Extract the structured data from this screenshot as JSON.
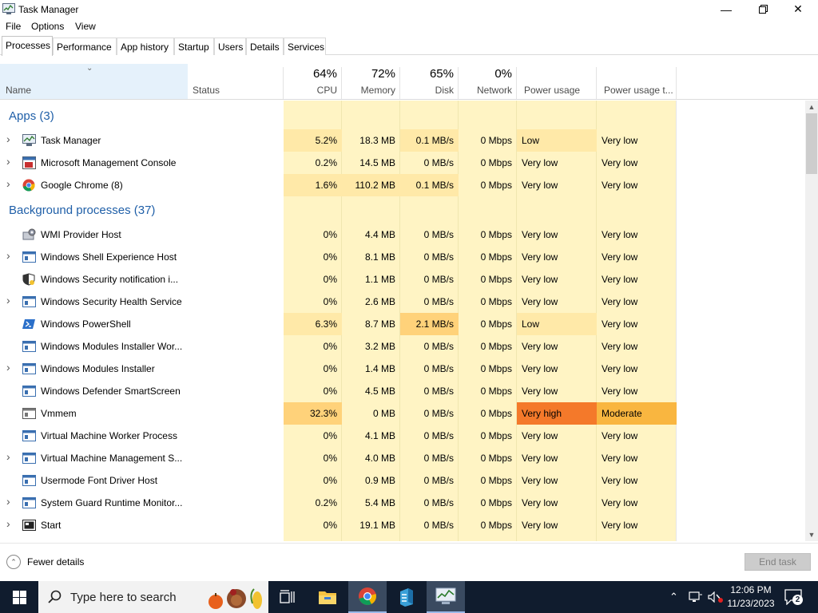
{
  "window": {
    "title": "Task Manager"
  },
  "menu": [
    "File",
    "Options",
    "View"
  ],
  "tabs": [
    "Processes",
    "Performance",
    "App history",
    "Startup",
    "Users",
    "Details",
    "Services"
  ],
  "columns": {
    "name": "Name",
    "status": "Status",
    "cpu": {
      "pct": "64%",
      "label": "CPU"
    },
    "memory": {
      "pct": "72%",
      "label": "Memory"
    },
    "disk": {
      "pct": "65%",
      "label": "Disk"
    },
    "network": {
      "pct": "0%",
      "label": "Network"
    },
    "power": "Power usage",
    "power_trend": "Power usage t..."
  },
  "groups": {
    "apps": "Apps (3)",
    "background": "Background processes (37)"
  },
  "apps": [
    {
      "name": "Task Manager",
      "cpu": "5.2%",
      "mem": "18.3 MB",
      "disk": "0.1 MB/s",
      "net": "0 Mbps",
      "power": "Low",
      "trend": "Very low"
    },
    {
      "name": "Microsoft Management Console",
      "cpu": "0.2%",
      "mem": "14.5 MB",
      "disk": "0 MB/s",
      "net": "0 Mbps",
      "power": "Very low",
      "trend": "Very low"
    },
    {
      "name": "Google Chrome (8)",
      "cpu": "1.6%",
      "mem": "110.2 MB",
      "disk": "0.1 MB/s",
      "net": "0 Mbps",
      "power": "Very low",
      "trend": "Very low"
    }
  ],
  "background": [
    {
      "name": "WMI Provider Host",
      "cpu": "0%",
      "mem": "4.4 MB",
      "disk": "0 MB/s",
      "net": "0 Mbps",
      "power": "Very low",
      "trend": "Very low"
    },
    {
      "name": "Windows Shell Experience Host",
      "cpu": "0%",
      "mem": "8.1 MB",
      "disk": "0 MB/s",
      "net": "0 Mbps",
      "power": "Very low",
      "trend": "Very low"
    },
    {
      "name": "Windows Security notification i...",
      "cpu": "0%",
      "mem": "1.1 MB",
      "disk": "0 MB/s",
      "net": "0 Mbps",
      "power": "Very low",
      "trend": "Very low"
    },
    {
      "name": "Windows Security Health Service",
      "cpu": "0%",
      "mem": "2.6 MB",
      "disk": "0 MB/s",
      "net": "0 Mbps",
      "power": "Very low",
      "trend": "Very low"
    },
    {
      "name": "Windows PowerShell",
      "cpu": "6.3%",
      "mem": "8.7 MB",
      "disk": "2.1 MB/s",
      "net": "0 Mbps",
      "power": "Low",
      "trend": "Very low"
    },
    {
      "name": "Windows Modules Installer Wor...",
      "cpu": "0%",
      "mem": "3.2 MB",
      "disk": "0 MB/s",
      "net": "0 Mbps",
      "power": "Very low",
      "trend": "Very low"
    },
    {
      "name": "Windows Modules Installer",
      "cpu": "0%",
      "mem": "1.4 MB",
      "disk": "0 MB/s",
      "net": "0 Mbps",
      "power": "Very low",
      "trend": "Very low"
    },
    {
      "name": "Windows Defender SmartScreen",
      "cpu": "0%",
      "mem": "4.5 MB",
      "disk": "0 MB/s",
      "net": "0 Mbps",
      "power": "Very low",
      "trend": "Very low"
    },
    {
      "name": "Vmmem",
      "cpu": "32.3%",
      "mem": "0 MB",
      "disk": "0 MB/s",
      "net": "0 Mbps",
      "power": "Very high",
      "trend": "Moderate"
    },
    {
      "name": "Virtual Machine Worker Process",
      "cpu": "0%",
      "mem": "4.1 MB",
      "disk": "0 MB/s",
      "net": "0 Mbps",
      "power": "Very low",
      "trend": "Very low"
    },
    {
      "name": "Virtual Machine Management S...",
      "cpu": "0%",
      "mem": "4.0 MB",
      "disk": "0 MB/s",
      "net": "0 Mbps",
      "power": "Very low",
      "trend": "Very low"
    },
    {
      "name": "Usermode Font Driver Host",
      "cpu": "0%",
      "mem": "0.9 MB",
      "disk": "0 MB/s",
      "net": "0 Mbps",
      "power": "Very low",
      "trend": "Very low"
    },
    {
      "name": "System Guard Runtime Monitor...",
      "cpu": "0.2%",
      "mem": "5.4 MB",
      "disk": "0 MB/s",
      "net": "0 Mbps",
      "power": "Very low",
      "trend": "Very low"
    },
    {
      "name": "Start",
      "cpu": "0%",
      "mem": "19.1 MB",
      "disk": "0 MB/s",
      "net": "0 Mbps",
      "power": "Very low",
      "trend": "Very low"
    }
  ],
  "footer": {
    "fewer_details": "Fewer details",
    "end_task": "End task"
  },
  "taskbar": {
    "search_placeholder": "Type here to search",
    "time": "12:06 PM",
    "date": "11/23/2023",
    "notifications": "2"
  },
  "colors": {
    "heat_low": "#fff4c4",
    "heat_mid": "#ffe9a8",
    "heat_high": "#ffd27a",
    "power_very_high": "#f4792a",
    "power_moderate": "#f9b640",
    "group_blue": "#1f5fa8"
  }
}
